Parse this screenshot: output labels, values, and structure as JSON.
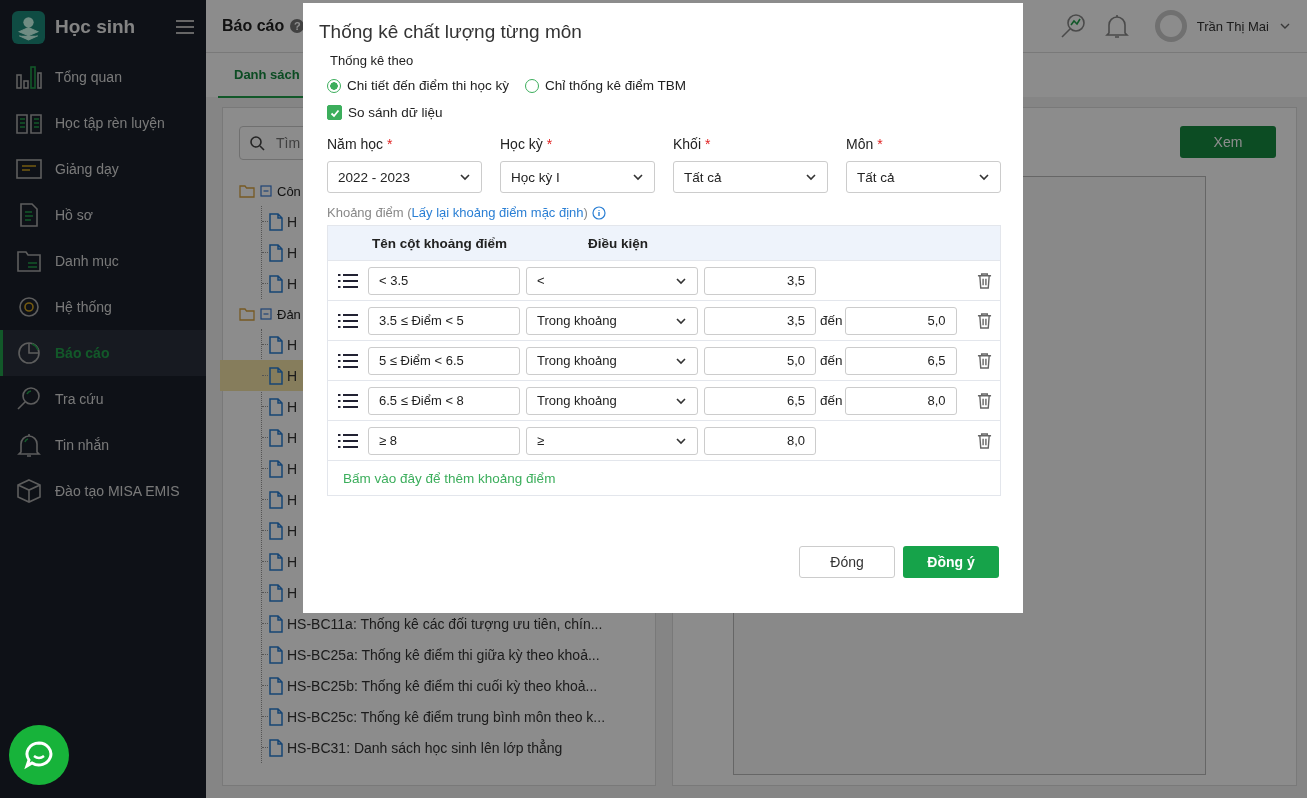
{
  "app": {
    "title": "Học sinh"
  },
  "sidebar": {
    "items": [
      {
        "label": "Tổng quan",
        "selected": false
      },
      {
        "label": "Học tập rèn luyện",
        "selected": false
      },
      {
        "label": "Giảng dạy",
        "selected": false
      },
      {
        "label": "Hồ sơ",
        "selected": false
      },
      {
        "label": "Danh mục",
        "selected": false
      },
      {
        "label": "Hệ thống",
        "selected": false
      },
      {
        "label": "Báo cáo",
        "selected": true
      },
      {
        "label": "Tra cứu",
        "selected": false
      },
      {
        "label": "Tin nhắn",
        "selected": false
      },
      {
        "label": "Đào tạo MISA EMIS",
        "selected": false
      }
    ]
  },
  "header": {
    "title": "Báo cáo",
    "help": "?",
    "user": "Trần Thị Mai"
  },
  "tabs": [
    {
      "label": "Danh sách",
      "selected": true
    }
  ],
  "report_tree": {
    "search_placeholder": "Tìm",
    "groups": [
      {
        "label": "Côn",
        "expanded": true,
        "children": [
          {
            "label": "H",
            "selected": false
          },
          {
            "label": "H",
            "selected": false
          },
          {
            "label": "H",
            "selected": false
          }
        ]
      },
      {
        "label": "Đản",
        "expanded": true,
        "children": [
          {
            "label": "H",
            "selected": false
          },
          {
            "label": "H",
            "selected": true
          },
          {
            "label": "H",
            "selected": false
          },
          {
            "label": "H",
            "selected": false
          },
          {
            "label": "H",
            "selected": false
          },
          {
            "label": "H",
            "selected": false
          },
          {
            "label": "H",
            "selected": false
          },
          {
            "label": "H",
            "selected": false
          },
          {
            "label": "H",
            "selected": false
          },
          {
            "label": "HS-BC11a: Thống kê các đối tượng ưu tiên, chín...",
            "selected": false
          },
          {
            "label": "HS-BC25a: Thống kê điểm thi giữa kỳ theo khoả...",
            "selected": false
          },
          {
            "label": "HS-BC25b: Thống kê điểm thi cuối kỳ theo khoả...",
            "selected": false
          },
          {
            "label": "HS-BC25c: Thống kê điểm trung bình môn theo k...",
            "selected": false
          },
          {
            "label": "HS-BC31: Danh sách học sinh lên lớp thẳng",
            "selected": false
          }
        ]
      }
    ]
  },
  "preview": {
    "view_button": "Xem"
  },
  "dialog": {
    "title": "Thống kê chất lượng từng môn",
    "mode_label": "Thống kê theo",
    "modes": [
      {
        "label": "Chi tiết đến điểm thi học kỳ",
        "selected": true
      },
      {
        "label": "Chỉ thống kê điểm TBM",
        "selected": false
      }
    ],
    "compare": {
      "label": "So sánh dữ liệu",
      "checked": true
    },
    "filters": [
      {
        "label": "Năm học",
        "required": true,
        "value": "2022 - 2023"
      },
      {
        "label": "Học kỳ",
        "required": true,
        "value": "Học kỳ I"
      },
      {
        "label": "Khối",
        "required": true,
        "value": "Tất cả"
      },
      {
        "label": "Môn",
        "required": true,
        "value": "Tất cả"
      }
    ],
    "required_mark": "*",
    "ranges_hint": {
      "before": "Khoảng điểm (",
      "link": "Lấy lại khoảng điểm mặc định",
      "after": ")"
    },
    "columns": [
      "Tên cột khoảng điểm",
      "Điều kiện"
    ],
    "ranges": [
      {
        "kind": "single",
        "name": "< 3.5",
        "condition": "<",
        "from": "3,5"
      },
      {
        "kind": "between",
        "name": "3.5 ≤ Điểm < 5",
        "condition": "Trong khoảng",
        "from": "3,5",
        "to_label": "đến",
        "to": "5,0"
      },
      {
        "kind": "between",
        "name": "5 ≤ Điểm < 6.5",
        "condition": "Trong khoảng",
        "from": "5,0",
        "to_label": "đến",
        "to": "6,5"
      },
      {
        "kind": "between",
        "name": "6.5 ≤ Điểm < 8",
        "condition": "Trong khoảng",
        "from": "6,5",
        "to_label": "đến",
        "to": "8,0"
      },
      {
        "kind": "single",
        "name": "≥ 8",
        "condition": "≥",
        "from": "8,0"
      }
    ],
    "add_link": "Bấm vào đây để thêm khoảng điểm",
    "buttons": [
      {
        "label": "Đóng",
        "kind": "secondary"
      },
      {
        "label": "Đồng ý",
        "kind": "primary"
      }
    ]
  }
}
